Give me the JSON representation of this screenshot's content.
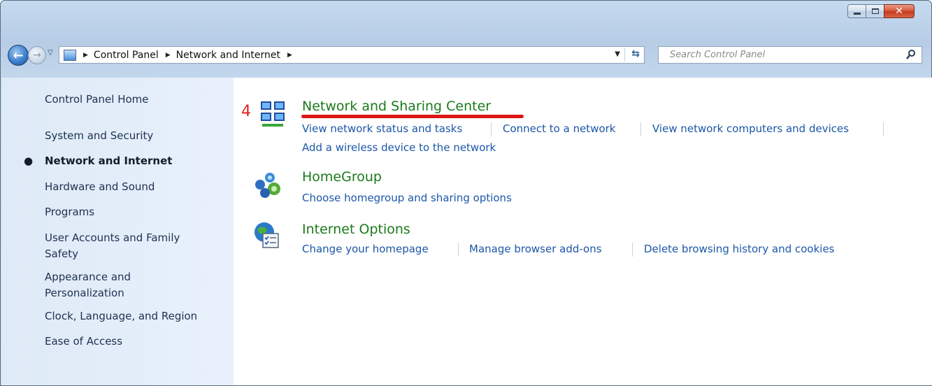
{
  "window": {
    "buttons": {
      "minimize": "minimize",
      "maximize": "maximize",
      "close": "✕"
    }
  },
  "nav": {
    "back": "back",
    "forward": "forward",
    "breadcrumb": [
      "Control Panel",
      "Network and Internet"
    ],
    "search_placeholder": "Search Control Panel"
  },
  "sidebar": {
    "items": [
      {
        "label": "Control Panel Home"
      },
      {
        "label": "System and Security"
      },
      {
        "label": "Network and Internet",
        "current": true
      },
      {
        "label": "Hardware and Sound"
      },
      {
        "label": "Programs"
      },
      {
        "label": "User Accounts and Family Safety"
      },
      {
        "label": "Appearance and Personalization"
      },
      {
        "label": "Clock, Language, and Region"
      },
      {
        "label": "Ease of Access"
      }
    ]
  },
  "annotation": {
    "number": "4"
  },
  "categories": [
    {
      "title": "Network and Sharing Center",
      "icon": "network-sharing-icon",
      "tasks": [
        "View network status and tasks",
        "Connect to a network",
        "View network computers and devices",
        "Add a wireless device to the network"
      ]
    },
    {
      "title": "HomeGroup",
      "icon": "homegroup-icon",
      "tasks": [
        "Choose homegroup and sharing options"
      ]
    },
    {
      "title": "Internet Options",
      "icon": "internet-options-icon",
      "tasks": [
        "Change your homepage",
        "Manage browser add-ons",
        "Delete browsing history and cookies"
      ]
    }
  ],
  "colors": {
    "category_title": "#1b7a1b",
    "task_link": "#1c57a8",
    "annotation": "#dd1616"
  }
}
